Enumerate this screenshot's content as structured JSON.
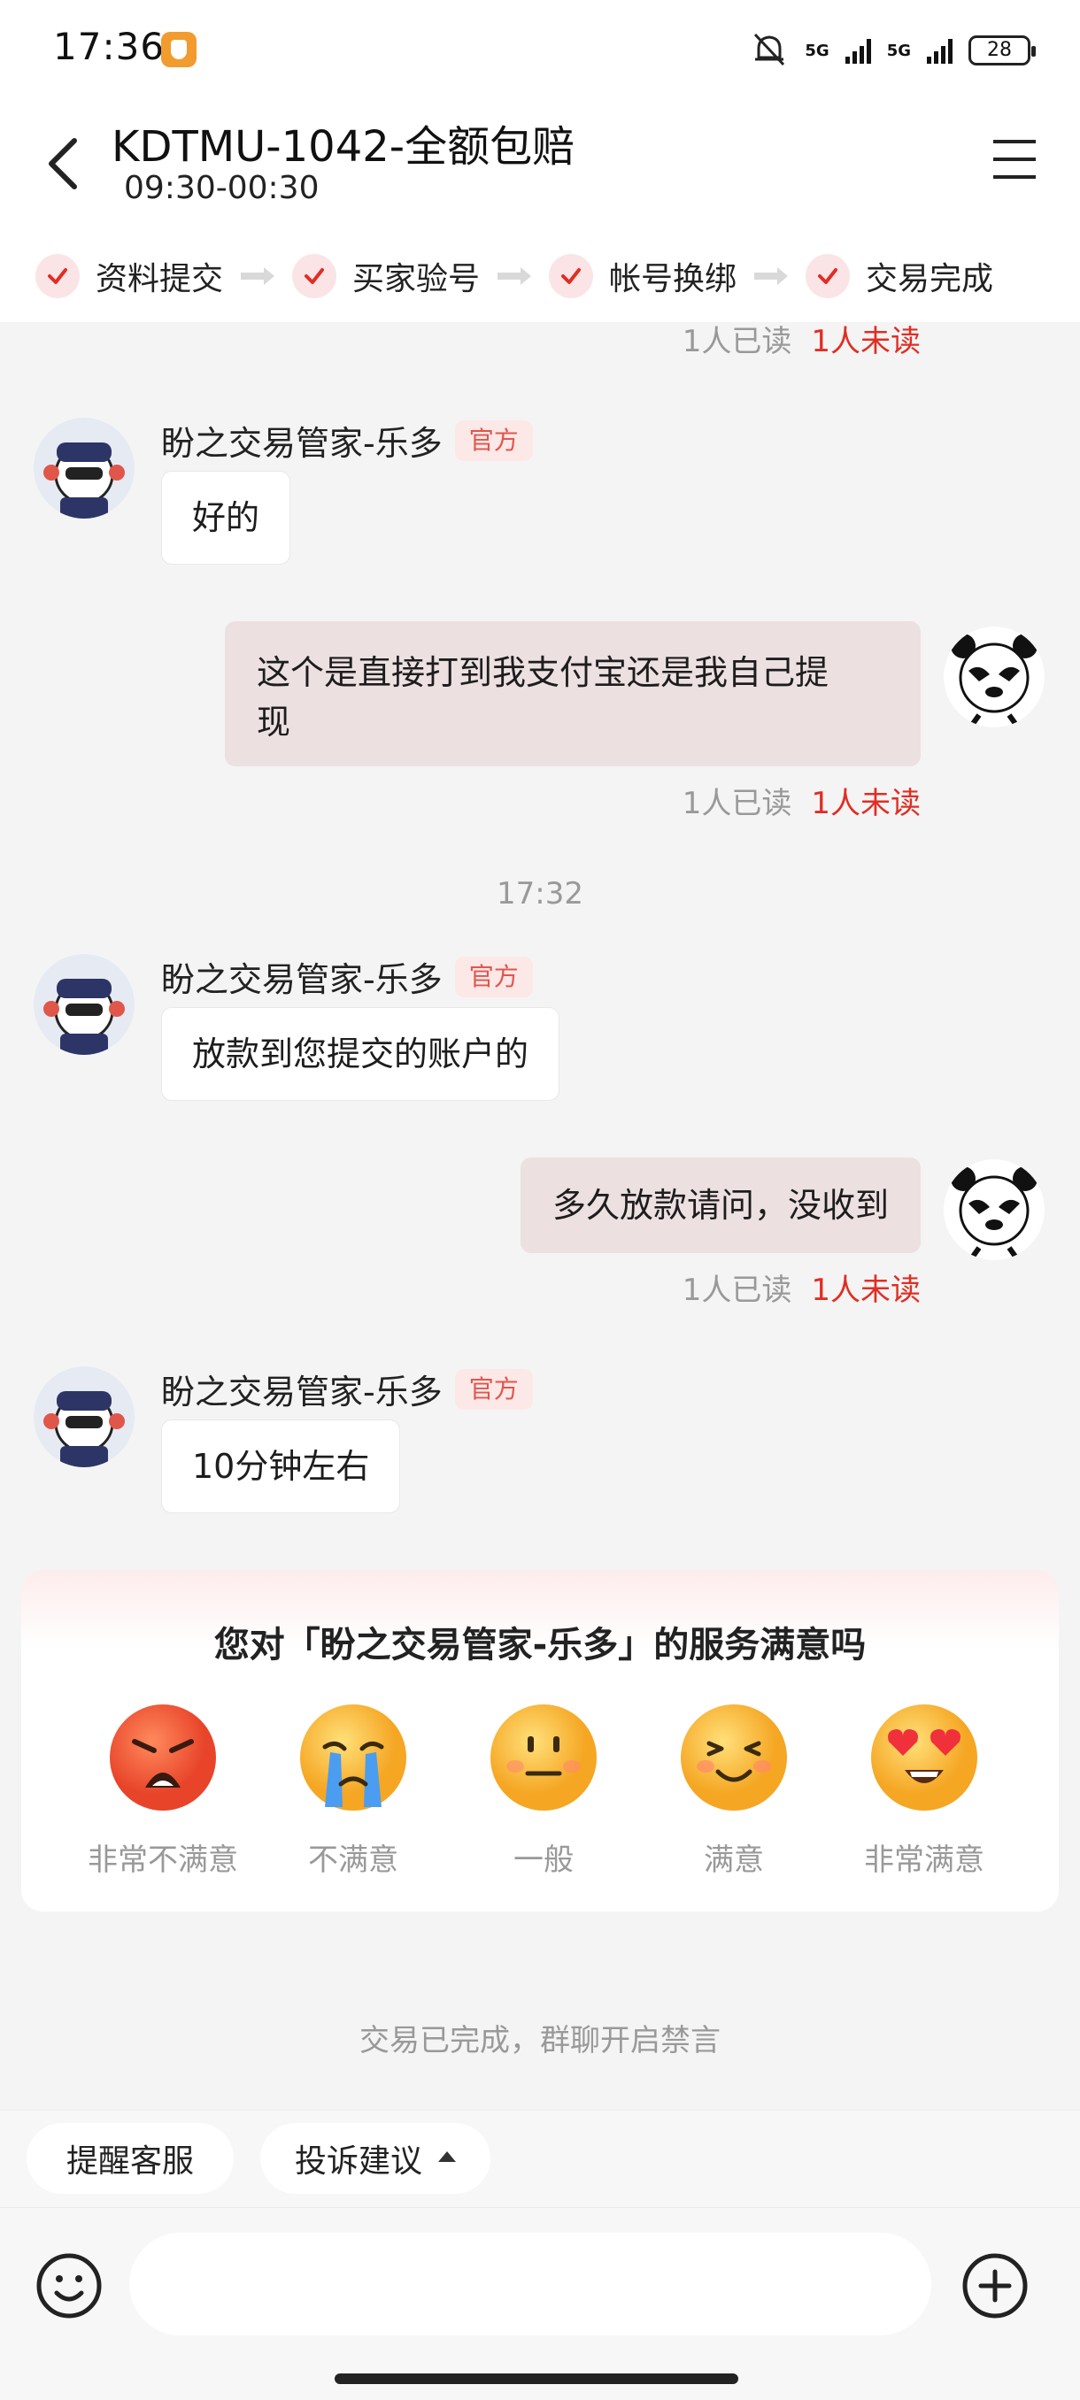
{
  "status_bar": {
    "time": "17:36",
    "network1": "5G",
    "network2": "5G",
    "battery": "28"
  },
  "header": {
    "title": "KDTMU-1042-全额包赔",
    "subtitle": "09:30-00:30"
  },
  "steps": [
    {
      "label": "资料提交"
    },
    {
      "label": "买家验号"
    },
    {
      "label": "帐号换绑"
    },
    {
      "label": "交易完成"
    }
  ],
  "read_status": {
    "read": "1人已读",
    "unread": "1人未读"
  },
  "messages": [
    {
      "sender": "盼之交易管家-乐多",
      "badge": "官方",
      "text": "好的"
    },
    {
      "text_line1": "这个是直接打到我支付宝还是我自己提",
      "text_line2": "现"
    },
    {
      "sender": "盼之交易管家-乐多",
      "badge": "官方",
      "text": "放款到您提交的账户的"
    },
    {
      "text": "多久放款请问，没收到"
    },
    {
      "sender": "盼之交易管家-乐多",
      "badge": "官方",
      "text": "10分钟左右"
    }
  ],
  "timestamp": "17:32",
  "survey": {
    "title": "您对「盼之交易管家-乐多」的服务满意吗",
    "options": [
      {
        "label": "非常不满意",
        "icon": "angry-face-icon"
      },
      {
        "label": "不满意",
        "icon": "crying-face-icon"
      },
      {
        "label": "一般",
        "icon": "neutral-face-icon"
      },
      {
        "label": "满意",
        "icon": "smiling-face-icon"
      },
      {
        "label": "非常满意",
        "icon": "heart-eyes-face-icon"
      }
    ]
  },
  "closed_note": "交易已完成，群聊开启禁言",
  "quick_actions": {
    "remind": "提醒客服",
    "complaint": "投诉建议"
  },
  "input": {
    "placeholder": ""
  },
  "colors": {
    "accent": "#e02e24",
    "bubble_out": "#ece0e1",
    "badge_bg": "#fde8e8"
  }
}
